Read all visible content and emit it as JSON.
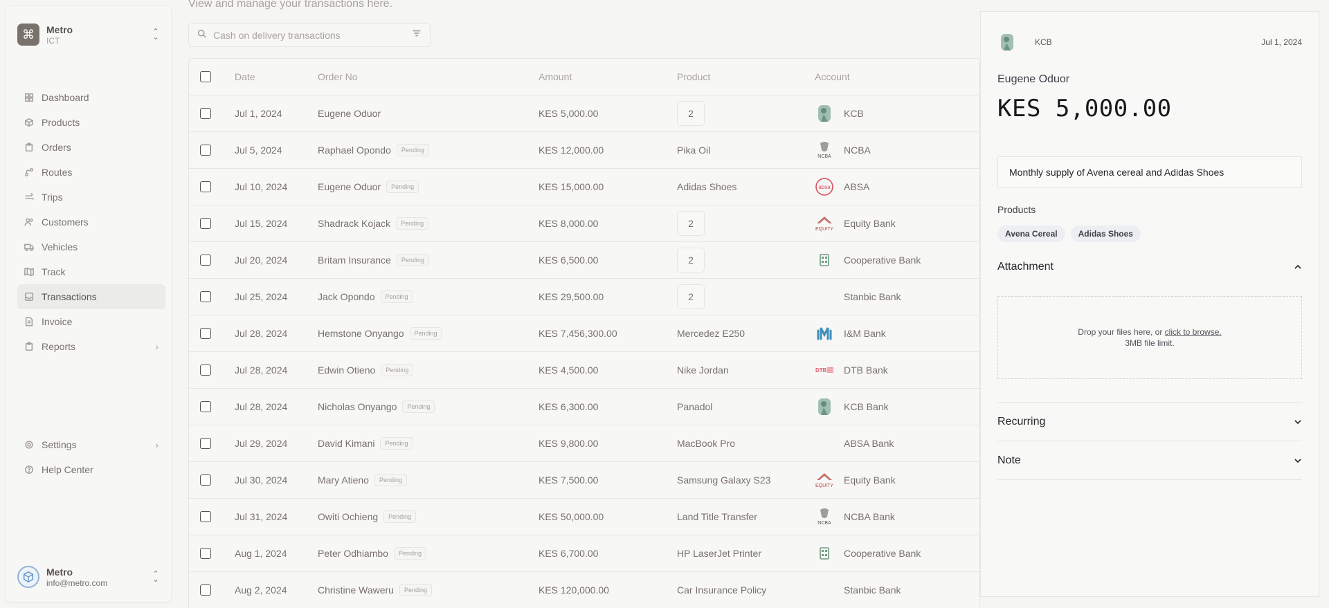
{
  "org": {
    "name": "Metro",
    "sub": "ICT"
  },
  "nav": [
    {
      "key": "dashboard",
      "label": "Dashboard",
      "icon": "dashboard-icon"
    },
    {
      "key": "products",
      "label": "Products",
      "icon": "box-icon"
    },
    {
      "key": "orders",
      "label": "Orders",
      "icon": "clipboard-icon"
    },
    {
      "key": "routes",
      "label": "Routes",
      "icon": "route-icon"
    },
    {
      "key": "trips",
      "label": "Trips",
      "icon": "wind-icon"
    },
    {
      "key": "customers",
      "label": "Customers",
      "icon": "users-icon"
    },
    {
      "key": "vehicles",
      "label": "Vehicles",
      "icon": "truck-icon"
    },
    {
      "key": "track",
      "label": "Track",
      "icon": "map-icon"
    },
    {
      "key": "transactions",
      "label": "Transactions",
      "icon": "inbox-icon",
      "active": true
    },
    {
      "key": "invoice",
      "label": "Invoice",
      "icon": "file-icon"
    },
    {
      "key": "reports",
      "label": "Reports",
      "icon": "clipboard-icon",
      "has_children": true
    }
  ],
  "nav_bottom": [
    {
      "key": "settings",
      "label": "Settings",
      "icon": "gear-icon",
      "has_children": true
    },
    {
      "key": "help",
      "label": "Help Center",
      "icon": "help-icon"
    }
  ],
  "user": {
    "name": "Metro",
    "email": "info@metro.com"
  },
  "main": {
    "subtitle": "View and manage your transactions here.",
    "search_placeholder": "Cash on delivery transactions"
  },
  "table": {
    "columns": [
      "Date",
      "Order No",
      "Amount",
      "Product",
      "Account"
    ],
    "rows": [
      {
        "date": "Jul 1, 2024",
        "order": "Eugene Oduor",
        "status": "",
        "amount": "KES 5,000.00",
        "product": "2",
        "product_is_qty": true,
        "account": "KCB",
        "logo": "kcb"
      },
      {
        "date": "Jul 5, 2024",
        "order": "Raphael Opondo",
        "status": "Pending",
        "amount": "KES 12,000.00",
        "product": "Pika Oil",
        "product_is_qty": false,
        "account": "NCBA",
        "logo": "ncba"
      },
      {
        "date": "Jul 10, 2024",
        "order": "Eugene Oduor",
        "status": "Pending",
        "amount": "KES 15,000.00",
        "product": "Adidas Shoes",
        "product_is_qty": false,
        "account": "ABSA",
        "logo": "absa"
      },
      {
        "date": "Jul 15, 2024",
        "order": "Shadrack Kojack",
        "status": "Pending",
        "amount": "KES 8,000.00",
        "product": "2",
        "product_is_qty": true,
        "account": "Equity Bank",
        "logo": "equity"
      },
      {
        "date": "Jul 20, 2024",
        "order": "Britam Insurance",
        "status": "Pending",
        "amount": "KES 6,500.00",
        "product": "2",
        "product_is_qty": true,
        "account": "Cooperative Bank",
        "logo": "coop"
      },
      {
        "date": "Jul 25, 2024",
        "order": "Jack Opondo",
        "status": "Pending",
        "amount": "KES 29,500.00",
        "product": "2",
        "product_is_qty": true,
        "account": "Stanbic Bank",
        "logo": ""
      },
      {
        "date": "Jul 28, 2024",
        "order": "Hemstone Onyango",
        "status": "Pending",
        "amount": "KES 7,456,300.00",
        "product": "Mercedez E250",
        "product_is_qty": false,
        "account": "I&M Bank",
        "logo": "im"
      },
      {
        "date": "Jul 28, 2024",
        "order": "Edwin Otieno",
        "status": "Pending",
        "amount": "KES 4,500.00",
        "product": "Nike Jordan",
        "product_is_qty": false,
        "account": "DTB Bank",
        "logo": "dtb"
      },
      {
        "date": "Jul 28, 2024",
        "order": "Nicholas Onyango",
        "status": "Pending",
        "amount": "KES 6,300.00",
        "product": "Panadol",
        "product_is_qty": false,
        "account": "KCB Bank",
        "logo": "kcb"
      },
      {
        "date": "Jul 29, 2024",
        "order": "David Kimani",
        "status": "Pending",
        "amount": "KES 9,800.00",
        "product": "MacBook Pro",
        "product_is_qty": false,
        "account": "ABSA Bank",
        "logo": ""
      },
      {
        "date": "Jul 30, 2024",
        "order": "Mary Atieno",
        "status": "Pending",
        "amount": "KES 7,500.00",
        "product": "Samsung Galaxy S23",
        "product_is_qty": false,
        "account": "Equity Bank",
        "logo": "equity"
      },
      {
        "date": "Jul 31, 2024",
        "order": "Owiti Ochieng",
        "status": "Pending",
        "amount": "KES 50,000.00",
        "product": "Land Title Transfer",
        "product_is_qty": false,
        "account": "NCBA Bank",
        "logo": "ncba"
      },
      {
        "date": "Aug 1, 2024",
        "order": "Peter Odhiambo",
        "status": "Pending",
        "amount": "KES 6,700.00",
        "product": "HP LaserJet Printer",
        "product_is_qty": false,
        "account": "Cooperative Bank",
        "logo": "coop"
      },
      {
        "date": "Aug 2, 2024",
        "order": "Christine Waweru",
        "status": "Pending",
        "amount": "KES 120,000.00",
        "product": "Car Insurance Policy",
        "product_is_qty": false,
        "account": "Stanbic Bank",
        "logo": ""
      }
    ]
  },
  "detail": {
    "bank": "KCB",
    "date": "Jul 1, 2024",
    "name": "Eugene Oduor",
    "amount": "KES 5,000.00",
    "description": "Monthly supply of Avena cereal and Adidas Shoes",
    "products_label": "Products",
    "products": [
      "Avena Cereal",
      "Adidas Shoes"
    ],
    "attachment_label": "Attachment",
    "drop_text": "Drop your files here, or ",
    "drop_link": "click to browse.",
    "drop_limit": "3MB file limit.",
    "recurring_label": "Recurring",
    "note_label": "Note"
  },
  "colors": {
    "background": "#f5f5f4",
    "active_nav": "#ebebea",
    "kcb_green": "#5a8f7a",
    "absa_red": "#d9505a",
    "equity_red": "#b5443e",
    "dtb_red": "#e25b6b",
    "im_blue": "#3e8eb8"
  }
}
